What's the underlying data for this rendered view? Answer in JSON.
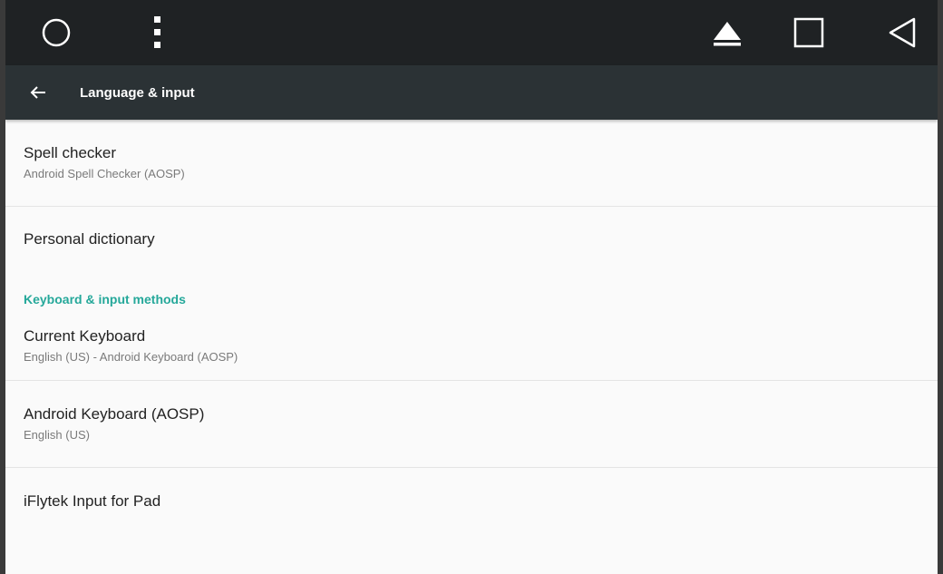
{
  "appbar": {
    "title": "Language & input"
  },
  "sysbar": {
    "icons": [
      "home-circle-icon",
      "menu-dots-icon",
      "eject-icon",
      "recents-square-icon",
      "back-triangle-icon"
    ]
  },
  "settings": {
    "spell_checker": {
      "title": "Spell checker",
      "summary": "Android Spell Checker (AOSP)"
    },
    "personal_dictionary": {
      "title": "Personal dictionary"
    },
    "category_keyboard": "Keyboard & input methods",
    "current_keyboard": {
      "title": "Current Keyboard",
      "summary": "English (US) - Android Keyboard (AOSP)"
    },
    "android_keyboard": {
      "title": "Android Keyboard (AOSP)",
      "summary": "English (US)"
    },
    "iflytek": {
      "title": "iFlytek Input for Pad"
    }
  },
  "colors": {
    "sysbar_bg": "#1f2224",
    "appbar_bg": "#2b3235",
    "accent": "#25a89a",
    "background": "#fafafa"
  }
}
